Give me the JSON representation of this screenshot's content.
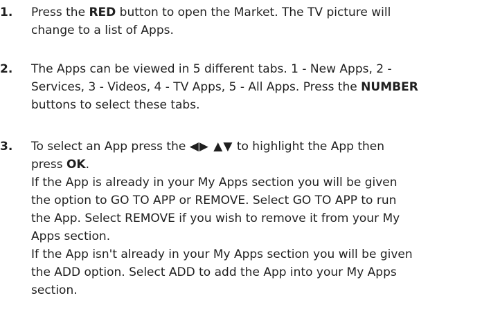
{
  "steps": [
    {
      "number": "1.",
      "l1_pre": "Press the ",
      "l1_bold": "RED",
      "l1_post": " button to open the Market. The TV picture will",
      "l2": "change to a list of Apps."
    },
    {
      "number": "2.",
      "l1": "The Apps can be viewed in 5 different tabs. 1 - New Apps, 2 -",
      "l2_pre": "Services, 3 - Videos, 4 - TV Apps, 5 - All Apps. Press the ",
      "l2_bold": "NUMBER",
      "l3": "buttons to select these tabs."
    },
    {
      "number": "3.",
      "l1_pre": "To select an App press the ",
      "l1_arrows": "◀▶ ▲▼",
      "l1_post": " to highlight the App then",
      "l2_pre": "press ",
      "l2_bold": "OK",
      "l2_post": ".",
      "l3": "If the App is already in your My Apps section you will be given",
      "l4": "the option to GO TO APP or REMOVE. Select GO TO APP to run",
      "l5": "the App. Select REMOVE if you wish to remove it from your My",
      "l6": "Apps section.",
      "l7": "If the App isn't already in your My Apps section you will be given",
      "l8": "the ADD option. Select ADD to add the App into your My Apps",
      "l9": "section."
    }
  ]
}
